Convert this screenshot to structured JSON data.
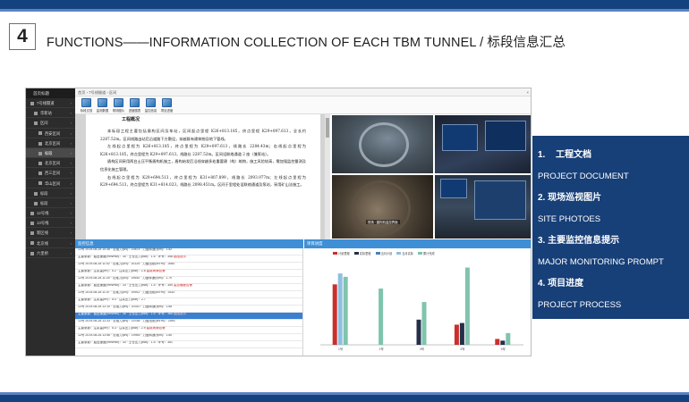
{
  "slide": {
    "number": "4",
    "title": "FUNCTIONS——INFORMATION COLLECTION OF EACH TBM TUNNEL / 标段信息汇总",
    "band_color": "#14427f",
    "bullets": [
      {
        "num": "1.",
        "cn": "工程文档",
        "en": "PROJECT DOCUMENT"
      },
      {
        "num": "2.",
        "cn": "现场巡视图片",
        "en": "SITE  PHOTOES"
      },
      {
        "num": "3.",
        "cn": "主要监控信息提示",
        "en": "MAJOR MONITORING PROMPT"
      },
      {
        "num": "4.",
        "cn": "项目进度",
        "en": "PROJECT PROCESS"
      }
    ]
  },
  "app": {
    "sidebar": {
      "header": "首页标题",
      "items": [
        {
          "label": "7号线隧道",
          "active": false
        },
        {
          "label": "华新站",
          "active": false
        },
        {
          "label": "区间",
          "active": false
        },
        {
          "label": "西安区间",
          "active": false
        },
        {
          "label": "北京区间",
          "active": false
        },
        {
          "label": "标段",
          "active": true
        },
        {
          "label": "北京区间",
          "active": false
        },
        {
          "label": "西三区间",
          "active": false
        },
        {
          "label": "华山区间",
          "active": false
        },
        {
          "label": "标段",
          "active": false
        },
        {
          "label": "标段",
          "active": false
        },
        {
          "label": "12号线",
          "active": false
        },
        {
          "label": "13号线",
          "active": false
        },
        {
          "label": "新区线",
          "active": false
        },
        {
          "label": "北京线",
          "active": false
        },
        {
          "label": "六里桥",
          "active": false
        }
      ]
    },
    "topbar": {
      "path": "首页 ›  7号线隧道 ›  区间",
      "close": "×"
    },
    "toolbar": [
      {
        "label": "标段文档"
      },
      {
        "label": "监测数据"
      },
      {
        "label": "现场图片"
      },
      {
        "label": "进度图表"
      },
      {
        "label": "监控信息"
      },
      {
        "label": "项目进度"
      }
    ],
    "document": {
      "title": "工程概况",
      "paragraphs": [
        "本标段工程主要包括盾构区间及车站，区间起点里程 K26+813.185，终点里程 K29+097.613，全长约 2287.52m。区间线路出站后沿道路下方敷设，穿越既有建筑物及地下管线。",
        "左线起点里程为 K26+813.185，终点里程为 K29+097.613，线路长 2284.43m；右线起点里程为 K26+813.185，终点里程为 K29+097.613，线路长 2287.52m。区间设联络通道 2 座（兼泵站）。",
        "盾构区间采用两台土压平衡盾构机施工，盾构始发后沿线穿越多处重要建（构）筑物，施工风险较高，需加强监控量测及信息化施工管理。",
        "右线起点里程为 K29+694.513，终点里程为 K31+807.899，线路长 2093.977m；左线起点里程为 K29+694.513，终点里程为 K31+814.023，线路长 2098.451m。区间于里程处设联络通道及泵站，采用矿山法施工。"
      ]
    },
    "photos": {
      "caption": "现场 · 盾构机监控界面"
    },
    "monitor": {
      "title": "监控信息",
      "rows": [
        {
          "text": "12号 2019-08-28 10:38 · 总推力(kN)：19874 · 刀盘转速(rpm)：1.82",
          "warn": "",
          "sel": false
        },
        {
          "text": "主要参数：掘进速度(mm/min)：35 · 土仓压力(bar)：1.6 · 环号：358",
          "warn": " 超限提示",
          "sel": false
        },
        {
          "text": "12号 2019-08-28 11:02 · 总推力(kN)：20125 · 刀盘扭矩(kN·m)：2650",
          "warn": "",
          "sel": false
        },
        {
          "text": "主要参数：注浆量(m³)：5.2 · 注浆压力(bar)：2.8",
          "warn": " 盾尾间隙告警",
          "sel": false
        },
        {
          "text": "12号 2019-08-28 11:25 · 总推力(kN)：19640 · 刀盘转速(rpm)：1.79",
          "warn": "",
          "sel": false
        },
        {
          "text": "主要参数：掘进速度(mm/min)：33 · 土仓压力(bar)：1.5 · 环号：359",
          "warn": " 姿态偏差告警",
          "sel": false
        },
        {
          "text": "12号 2019-08-28 11:47 · 总推力(kN)：19902 · 刀盘扭矩(kN·m)：2610",
          "warn": "",
          "sel": false
        },
        {
          "text": "主要参数：注浆量(m³)：5.0 · 注浆压力(bar)：2.7",
          "warn": "",
          "sel": false
        },
        {
          "text": "12号 2019-08-28 12:10 · 总推力(kN)：20310 · 刀盘转速(rpm)：1.85",
          "warn": "",
          "sel": false
        },
        {
          "text": "主要参数：掘进速度(mm/min)：36 · 土仓压力(bar)：1.6 · 环号：360",
          "warn": " 超限提示",
          "sel": true
        },
        {
          "text": "12号 2019-08-28 12:33 · 总推力(kN)：19788 · 刀盘扭矩(kN·m)：2590",
          "warn": "",
          "sel": false
        },
        {
          "text": "主要参数：注浆量(m³)：5.3 · 注浆压力(bar)：2.9",
          "warn": " 盾尾间隙告警",
          "sel": false
        },
        {
          "text": "12号 2019-08-28 12:56 · 总推力(kN)：19955 · 刀盘转速(rpm)：1.80",
          "warn": "",
          "sel": false
        },
        {
          "text": "主要参数：掘进速度(mm/min)：34 · 土仓压力(bar)：1.5 · 环号：361",
          "warn": "",
          "sel": false
        }
      ]
    },
    "colors": {
      "accent": "#3f8fd6",
      "sidebar": "#2c2c2c"
    }
  },
  "chart_data": {
    "type": "bar",
    "title": "项目进度",
    "categories": [
      "1号",
      "2号",
      "3号",
      "4号",
      "5号"
    ],
    "series": [
      {
        "name": "计划里程",
        "color": "#c9302c",
        "values": [
          72,
          0,
          0,
          24,
          7
        ]
      },
      {
        "name": "实际里程",
        "color": "#24304a",
        "values": [
          0,
          0,
          30,
          26,
          5
        ]
      },
      {
        "name": "当月计划",
        "color": "#4b7fbf",
        "values": [
          0,
          0,
          0,
          0,
          0
        ]
      },
      {
        "name": "当月实际",
        "color": "#8fbfe0",
        "values": [
          85,
          0,
          0,
          0,
          0
        ]
      },
      {
        "name": "累计完成",
        "color": "#7fc4ad",
        "values": [
          81,
          67,
          51,
          92,
          14
        ]
      }
    ],
    "ylim": [
      0,
      100
    ],
    "legend": "top",
    "grid": false
  }
}
